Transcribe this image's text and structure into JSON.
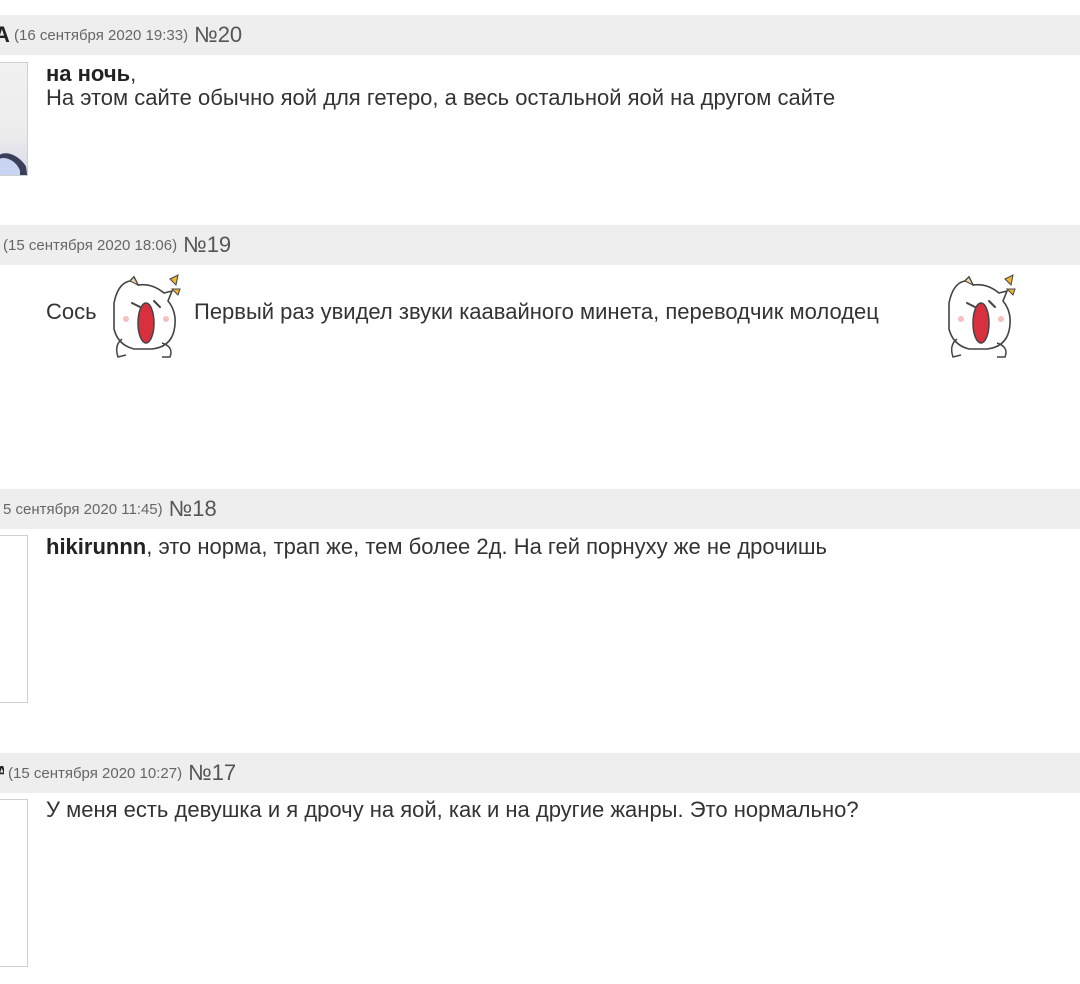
{
  "comments": [
    {
      "user_visible": "",
      "date": "(16 сентября 2020 19:33)",
      "number": "№20",
      "reply_to": "на ночь",
      "reply_sep": ",",
      "text": "На этом сайте обычно яой для гетеро, а весь остальной яой на другом сайте"
    },
    {
      "user_visible": "",
      "date": "(15 сентября 2020 18:06)",
      "number": "№19",
      "text_before": "Сось",
      "text_middle": "Первый раз увидел звуки каавайного минета, переводчик молодец",
      "sticker": "screaming-cat-sticker"
    },
    {
      "user_visible": "",
      "date": "5 сентября 2020 11:45)",
      "number": "№18",
      "reply_to": "hikirunnn",
      "reply_sep": ",",
      "text": " это норма, трап же, тем более 2д. На гей порнуху же не дрочишь"
    },
    {
      "user_visible": "",
      "date": "(15 сентября 2020 10:27)",
      "number": "№17",
      "text": "У меня есть девушка и я дрочу на яой, как и на другие жанры. Это нормально?"
    }
  ],
  "colors": {
    "header_bg": "#eeeeee",
    "text": "#333333",
    "date": "#666666",
    "sticker_mouth": "#d9303d",
    "sticker_star": "#f2b431"
  }
}
